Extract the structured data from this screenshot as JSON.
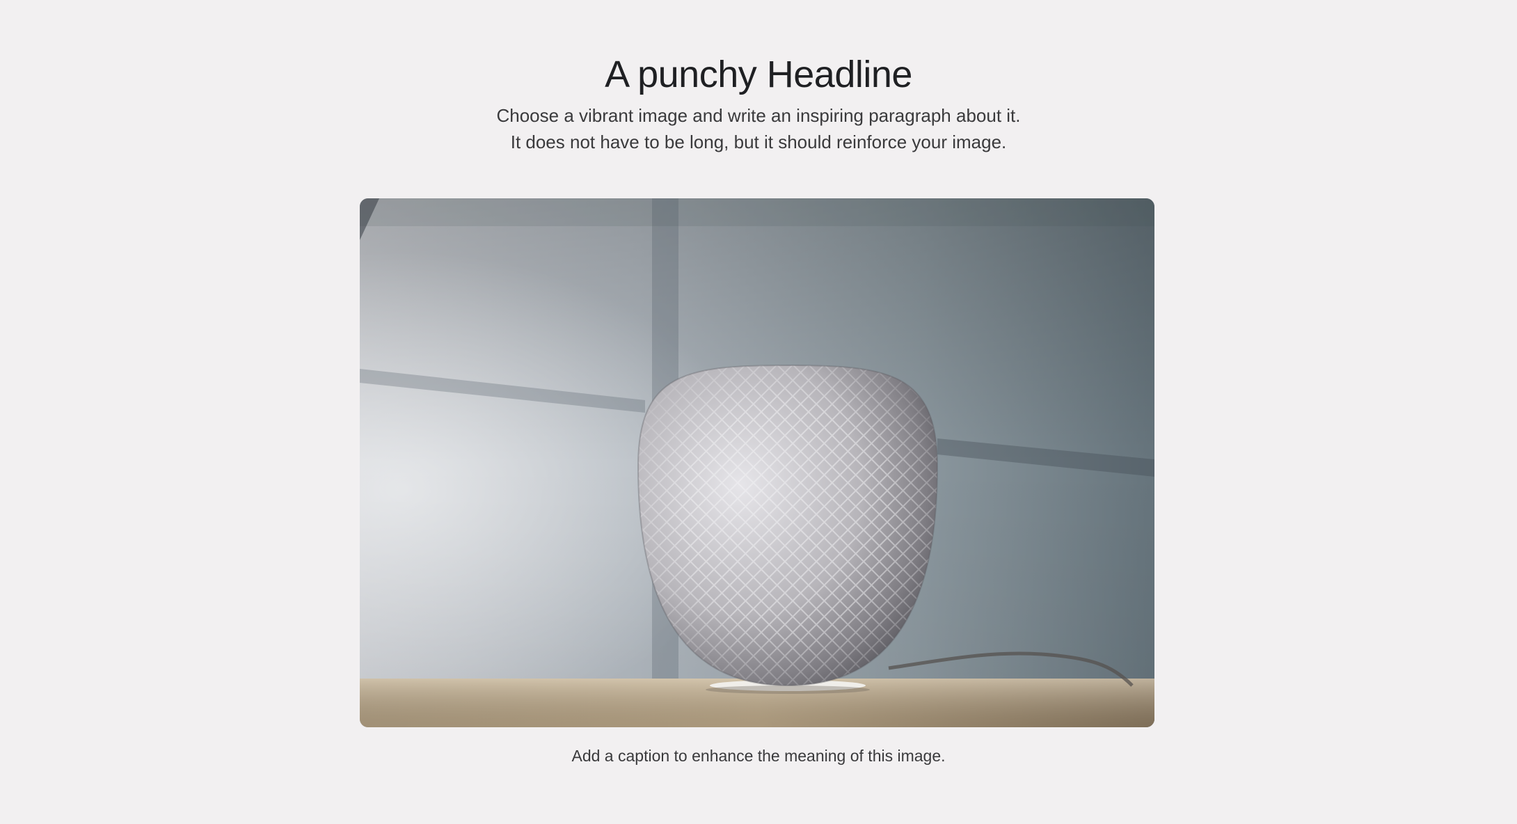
{
  "hero_section": {
    "headline": "A punchy Headline",
    "paragraph_line_1": "Choose a vibrant image and write an inspiring paragraph about it.",
    "paragraph_line_2": "It does not have to be long, but it should reinforce your image."
  },
  "figure": {
    "image_subject": "spherical mesh smart speaker on wooden table",
    "caption": "Add a caption to enhance the meaning of this image."
  },
  "colors": {
    "page_background": "#f2f0f1",
    "headline_text": "#1f2023",
    "body_text": "#3a3a3c"
  }
}
